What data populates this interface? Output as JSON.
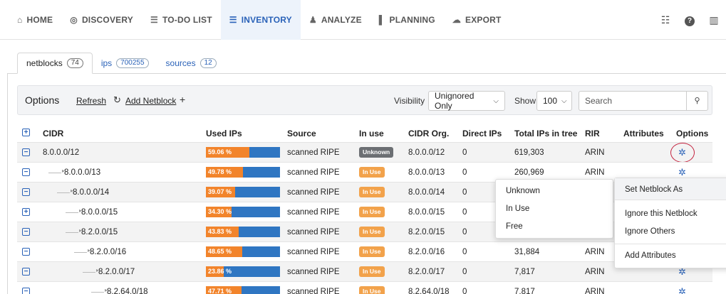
{
  "nav": {
    "items": [
      {
        "label": "HOME",
        "icon": "home-icon",
        "glyph": "⌂"
      },
      {
        "label": "DISCOVERY",
        "icon": "discovery-icon",
        "glyph": "◎"
      },
      {
        "label": "TO-DO LIST",
        "icon": "checklist-icon",
        "glyph": "☰"
      },
      {
        "label": "INVENTORY",
        "icon": "list-icon",
        "glyph": "☰"
      },
      {
        "label": "ANALYZE",
        "icon": "people-icon",
        "glyph": "♟"
      },
      {
        "label": "PLANNING",
        "icon": "bar-chart-icon",
        "glyph": "▌"
      },
      {
        "label": "EXPORT",
        "icon": "cloud-icon",
        "glyph": "☁"
      }
    ],
    "active": "INVENTORY",
    "right_icons": [
      "sliders-icon",
      "help-icon",
      "book-icon"
    ]
  },
  "tabs": [
    {
      "label": "netblocks",
      "count": "74"
    },
    {
      "label": "ips",
      "count": "700255"
    },
    {
      "label": "sources",
      "count": "12"
    }
  ],
  "options": {
    "title": "Options",
    "refresh": "Refresh",
    "add": "Add Netblock",
    "visibility_label": "Visibility",
    "visibility_value": "Unignored Only",
    "show_label": "Show",
    "show_value": "100",
    "search_placeholder": "Search"
  },
  "table": {
    "headers": [
      "CIDR",
      "Used IPs",
      "Source",
      "In use",
      "CIDR Org.",
      "Direct IPs",
      "Total IPs in tree",
      "RIR",
      "Attributes",
      "Options"
    ],
    "rows": [
      {
        "cidr": "8.0.0.0/12",
        "depth": 0,
        "expand": "⊟",
        "used": "59.06 %",
        "used_pct": 59.06,
        "source": "scanned RIPE",
        "status": "Unknown",
        "org": "8.0.0.0/12",
        "direct": "0",
        "total": "619,303",
        "rir": "ARIN",
        "gear": true
      },
      {
        "cidr": "8.0.0.0/13",
        "depth": 1,
        "expand": "⊟",
        "used": "49.78 %",
        "used_pct": 49.78,
        "source": "scanned RIPE",
        "status": "In Use",
        "org": "8.0.0.0/13",
        "direct": "0",
        "total": "260,969",
        "rir": "ARIN",
        "gear": true
      },
      {
        "cidr": "8.0.0.0/14",
        "depth": 2,
        "expand": "⊟",
        "used": "39.07 %",
        "used_pct": 39.07,
        "source": "scanned RIPE",
        "status": "In Use",
        "org": "8.0.0.0/14",
        "direct": "0",
        "total": "",
        "rir": "",
        "gear": false
      },
      {
        "cidr": "8.0.0.0/15",
        "depth": 3,
        "expand": "⊞",
        "used": "34.30 %",
        "used_pct": 34.3,
        "source": "scanned RIPE",
        "status": "In Use",
        "org": "8.0.0.0/15",
        "direct": "0",
        "total": "",
        "rir": "",
        "gear": false
      },
      {
        "cidr": "8.2.0.0/15",
        "depth": 3,
        "expand": "⊟",
        "used": "43.83 %",
        "used_pct": 43.83,
        "source": "scanned RIPE",
        "status": "In Use",
        "org": "8.2.0.0/15",
        "direct": "0",
        "total": "",
        "rir": "",
        "gear": false
      },
      {
        "cidr": "8.2.0.0/16",
        "depth": 4,
        "expand": "⊟",
        "used": "48.65 %",
        "used_pct": 48.65,
        "source": "scanned RIPE",
        "status": "In Use",
        "org": "8.2.0.0/16",
        "direct": "0",
        "total": "31,884",
        "rir": "ARIN",
        "gear": false
      },
      {
        "cidr": "8.2.0.0/17",
        "depth": 5,
        "expand": "⊟",
        "used": "23.86 %",
        "used_pct": 23.86,
        "source": "scanned RIPE",
        "status": "In Use",
        "org": "8.2.0.0/17",
        "direct": "0",
        "total": "7,817",
        "rir": "ARIN",
        "gear": true
      },
      {
        "cidr": "8.2.64.0/18",
        "depth": 6,
        "expand": "⊟",
        "used": "47.71 %",
        "used_pct": 47.71,
        "source": "scanned RIPE",
        "status": "In Use",
        "org": "8.2.64.0/18",
        "direct": "0",
        "total": "7,817",
        "rir": "ARIN",
        "gear": true
      }
    ]
  },
  "status_menu": [
    "Unknown",
    "In Use",
    "Free"
  ],
  "options_menu": {
    "head": "Set Netblock As",
    "items": [
      "Ignore this Netblock",
      "Ignore Others",
      "Add Attributes"
    ]
  },
  "colors": {
    "accent": "#2a62b8",
    "used_fill": "#f2842b",
    "used_bg": "#2f76c2",
    "in_use": "#f2a24b",
    "unknown": "#6c6f73",
    "highlight_ring": "#c4233f"
  }
}
